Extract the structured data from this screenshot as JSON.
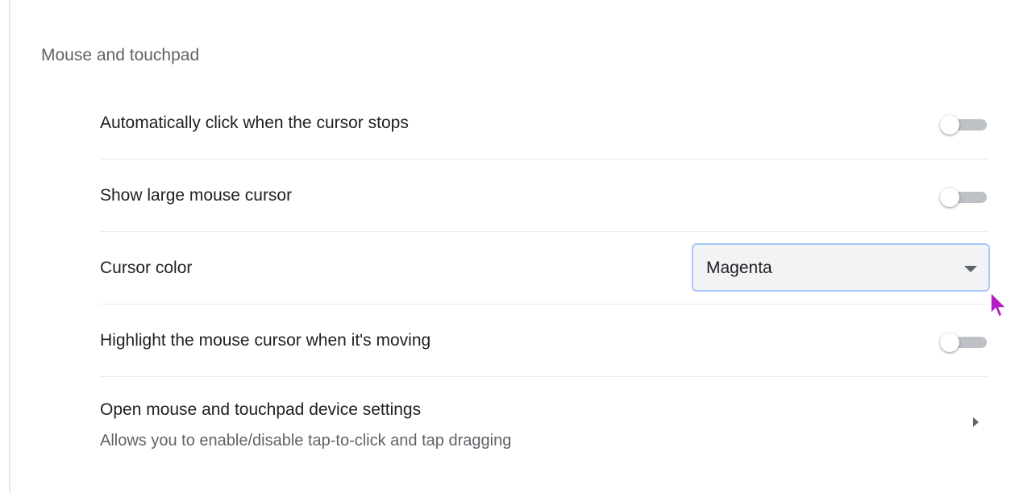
{
  "section": {
    "title": "Mouse and touchpad"
  },
  "rows": {
    "auto_click": {
      "label": "Automatically click when the cursor stops",
      "toggle_on": false
    },
    "large_cursor": {
      "label": "Show large mouse cursor",
      "toggle_on": false
    },
    "cursor_color": {
      "label": "Cursor color",
      "selected": "Magenta"
    },
    "highlight_cursor": {
      "label": "Highlight the mouse cursor when it's moving",
      "toggle_on": false
    },
    "device_settings": {
      "label": "Open mouse and touchpad device settings",
      "sublabel": "Allows you to enable/disable tap-to-click and tap dragging"
    }
  },
  "colors": {
    "cursor": "#b51ec4",
    "select_border": "#a8c7fa",
    "toggle_track_off": "#bdc1c6"
  },
  "icons": {
    "mouse_pointer": "mouse-pointer-icon",
    "dropdown": "chevron-down-icon",
    "subpage": "chevron-right-icon"
  }
}
